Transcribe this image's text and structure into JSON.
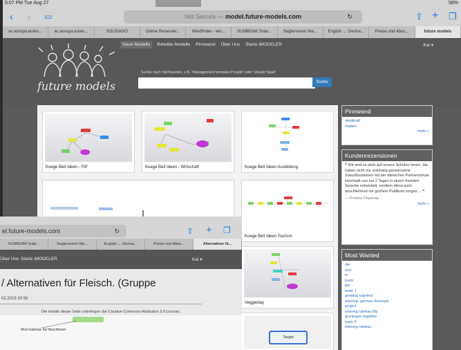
{
  "status_bar": {
    "time": "5:07 PM  Tue Aug 27",
    "signal": "58%"
  },
  "browser": {
    "url_prefix": "Not Secure — ",
    "url_host": "model.future-models.com",
    "tabs": [
      "ec.europa.eu/en...",
      "ec.europa.eu/en...",
      "SOLIDAGO",
      "Online Reservier...",
      "Windfinder - win...",
      "SUNBEAM Solar...",
      "Seglerverein Nie...",
      "English ↔ Germa...",
      "Preise und Abos...",
      "future models"
    ]
  },
  "site": {
    "menu": [
      "Neue Modelle",
      "Beliebte Modelle",
      "Pinnwand",
      "Über Uns",
      "Starte iMODELER"
    ],
    "user": "Kai ▾",
    "logo": "future models",
    "search_hint": "Suche nach Stichworten, z.B. 'Management komplex Projekt' oder 'Urlaub Spaß'",
    "search_button": "Suche"
  },
  "cards": [
    {
      "title": "Koege Belt Ideen - FIP"
    },
    {
      "title": "Koege Belt Ideen - Wirtschaft"
    },
    {
      "title": "Koege Belt Ideen Ausbildung"
    },
    {
      "title": "Koege Belt Ideen Tourism"
    },
    {
      "title": "Veggieday"
    },
    {
      "title": "Target"
    }
  ],
  "pinnwand": {
    "title": "Pinnwand",
    "links": [
      "windkraft",
      "maden"
    ],
    "more": "mehr »"
  },
  "reviews": {
    "title": "Kundenrezensionen",
    "text": "❝ Wir sind so stolz auf unsere Schüler/-innen. Sie haben nicht nur erstmalig gemeinsame Zukunftsvisionen mit der dänischen Partnerschule innerhalb von nur 2 Tagen in einem fremden Sprache entwickelt, sondern diese auch anschließend vor großem Publikum vorges ... ❞",
    "author": "— Kristina Depenau",
    "more": "mehr »"
  },
  "most_wanted": {
    "title": "Most Wanted",
    "links": [
      "der",
      "und",
      "in",
      "team",
      "per",
      "team 7",
      "growing together",
      "interreg- german denmark",
      "project",
      "interreg ratekau lilly",
      "groningen together",
      "team 5",
      "interreg ratekau"
    ]
  },
  "front_window": {
    "url": "el.future-models.com",
    "tabs": [
      "SUNBEAM Solar...",
      "Seglerverein Nie...",
      "English ↔ Germa...",
      "Preise und Abos...",
      "Alternativer til..."
    ],
    "menu": [
      "Über Uns",
      "Starte iMODELER"
    ],
    "user": "Kai ▾",
    "title": "/ Alternativen für Fleisch. (Gruppe",
    "date": "02.2019 20:56",
    "license": "Die Inhalte dieser Seite unterliegen der Creative Commons Attribution 3.0 License.",
    "node_text": "Mod material- für fleischlosen"
  },
  "colors": {
    "accent": "#337ab7",
    "link": "#2a6fbd",
    "nav_icon": "#1f7ae0"
  }
}
